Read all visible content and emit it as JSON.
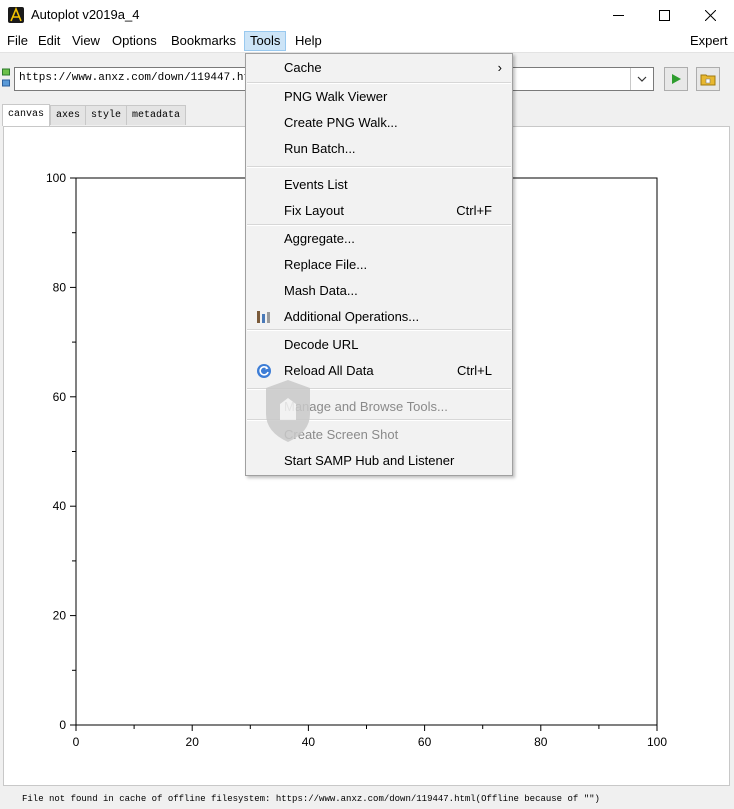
{
  "window": {
    "title": "Autoplot v2019a_4",
    "minimize_glyph": "—",
    "maximize_glyph": "☐",
    "close_glyph": "✕"
  },
  "menubar": {
    "file": "File",
    "edit": "Edit",
    "view": "View",
    "options": "Options",
    "bookmarks": "Bookmarks",
    "tools": "Tools",
    "help": "Help",
    "expert": "Expert"
  },
  "toolbar": {
    "url_value": "https://www.anxz.com/down/119447.html",
    "dropdown_glyph": "⌄"
  },
  "tabs": [
    "canvas",
    "axes",
    "style",
    "metadata"
  ],
  "chart_data": {
    "type": "line",
    "x": [],
    "series": [],
    "xlim": [
      0,
      100
    ],
    "ylim": [
      0,
      100
    ],
    "xticks": [
      "0",
      "20",
      "40",
      "60",
      "80",
      "100"
    ],
    "yticks": [
      "0",
      "20",
      "40",
      "60",
      "80",
      "100"
    ],
    "title": "",
    "xlabel": "",
    "ylabel": "",
    "grid": false
  },
  "tools_menu": {
    "cache": "Cache",
    "submenu_arrow": "›",
    "png_walk_viewer": "PNG Walk Viewer",
    "create_png_walk": "Create PNG Walk...",
    "run_batch": "Run Batch...",
    "events_list": "Events List",
    "fix_layout": "Fix Layout",
    "fix_layout_shortcut": "Ctrl+F",
    "aggregate": "Aggregate...",
    "replace_file": "Replace File...",
    "mash_data": "Mash Data...",
    "additional_operations": "Additional Operations...",
    "decode_url": "Decode URL",
    "reload_all_data": "Reload All Data",
    "reload_shortcut": "Ctrl+L",
    "manage_browse_tools": "Manage and Browse Tools...",
    "create_screen_shot": "Create Screen Shot",
    "start_samp": "Start SAMP Hub and Listener"
  },
  "status": {
    "text": "File not found in cache of offline filesystem: https://www.anxz.com/down/119447.html(Offline because of \"\")"
  },
  "colors": {
    "menu_highlight": "#cce4f7",
    "run_button_green": "#2e9d2e",
    "folder_yellow": "#e8b830"
  }
}
